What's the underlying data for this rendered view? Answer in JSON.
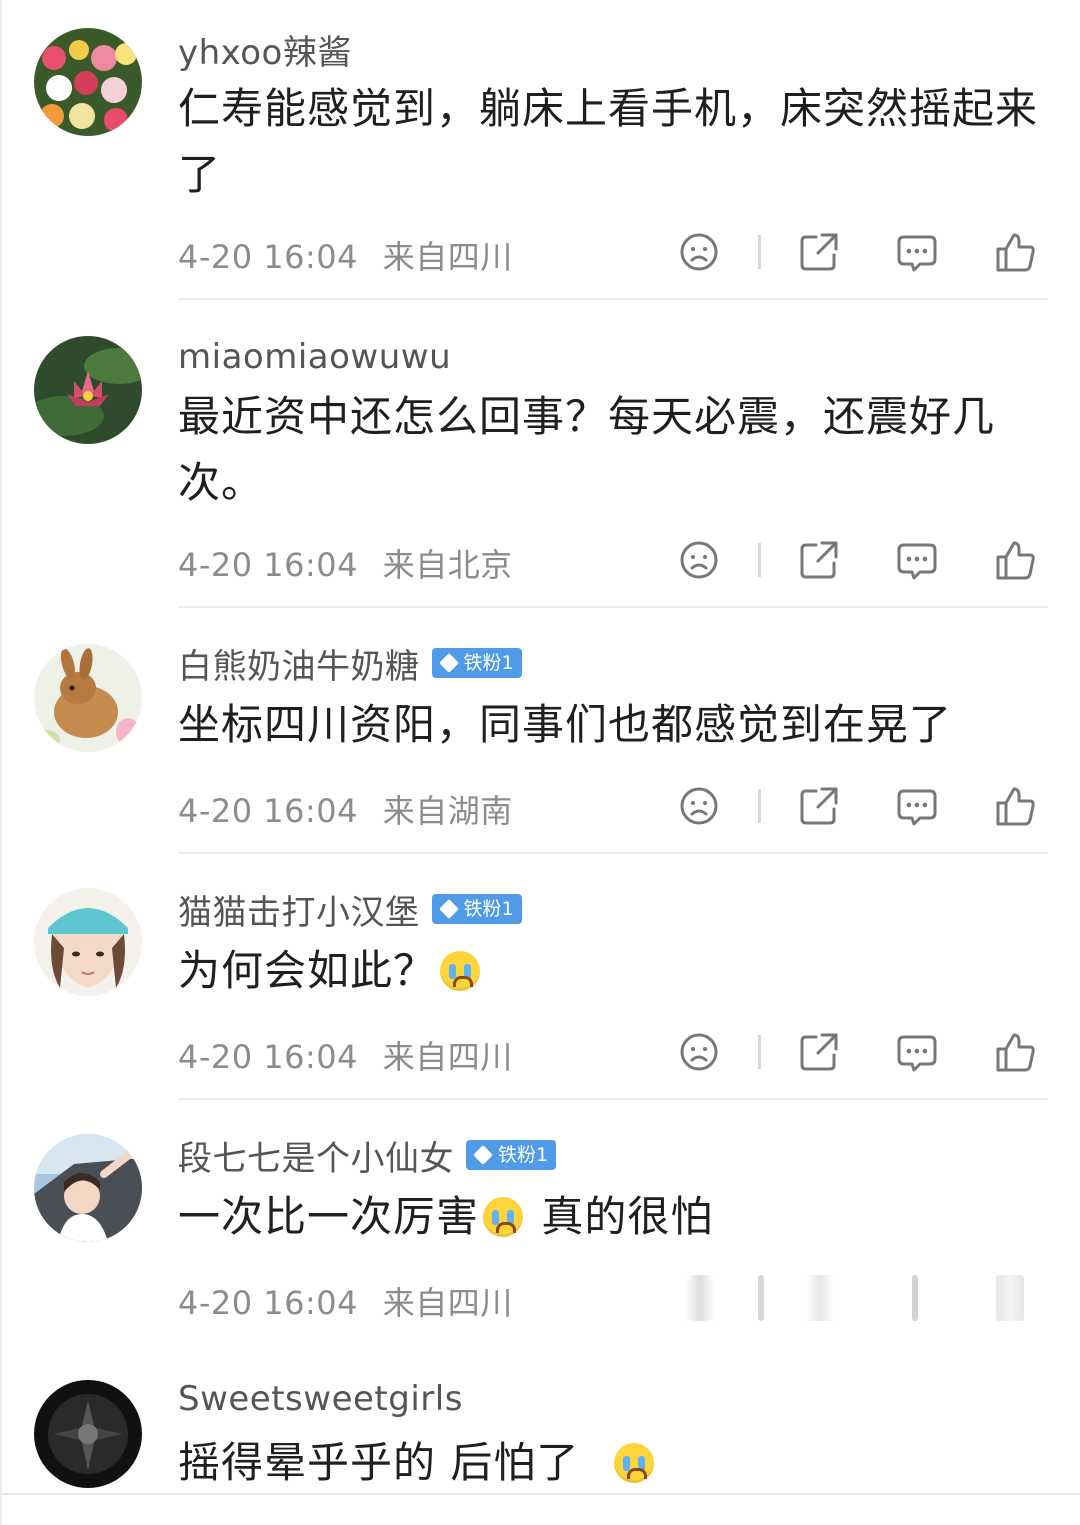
{
  "comments": [
    {
      "name": "yhxoo辣酱",
      "badge": "",
      "text": "仁寿能感觉到，躺床上看手机，床突然摇起来了",
      "emoji_after": false,
      "time": "4-20 16:04",
      "location": "来自四川"
    },
    {
      "name": "miaomiaowuwu",
      "badge": "",
      "text": "最近资中还怎么回事？每天必震，还震好几次。",
      "time": "4-20 16:04",
      "location": "来自北京"
    },
    {
      "name": "白熊奶油牛奶糖",
      "badge": "铁粉1",
      "text": "坐标四川资阳，同事们也都感觉到在晃了",
      "time": "4-20 16:04",
      "location": "来自湖南"
    },
    {
      "name": "猫猫击打小汉堡",
      "badge": "铁粉1",
      "text": "为何会如此？",
      "time": "4-20 16:04",
      "location": "来自四川"
    },
    {
      "name": "段七七是个小仙女",
      "badge": "铁粉1",
      "text_a": "一次比一次厉害",
      "text_b": " 真的很怕",
      "time": "4-20 16:04",
      "location": "来自四川"
    },
    {
      "name": "Sweetsweetgirls",
      "badge": "",
      "text": "摇得晕乎乎的 后怕了"
    }
  ],
  "icons": [
    "unhappy-face-icon",
    "share-icon",
    "comment-icon",
    "like-icon",
    "crying-emoji-icon",
    "laughing-crying-emoji-icon"
  ],
  "colors": {
    "badge": "#4f9be8",
    "meta": "#8c8c8c",
    "name": "#555555",
    "text": "#1f1f1f"
  }
}
